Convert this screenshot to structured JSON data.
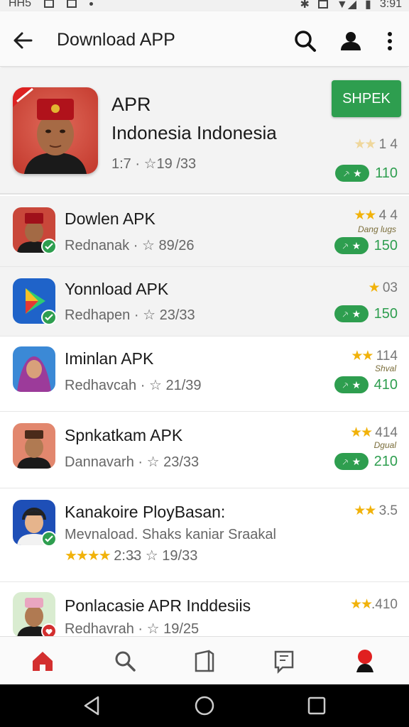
{
  "status_bar": {
    "left_text": "HH5",
    "right_text": "3:91"
  },
  "app_bar": {
    "title": "Download APP"
  },
  "featured": {
    "name": "APR",
    "subtitle": "Indonesia Indonesia",
    "meta_prefix": "1:7 ·",
    "meta_count": "19 /33",
    "install_label": "SHPEK",
    "rating_value": "1 4",
    "download_count": "110"
  },
  "apps": [
    {
      "name": "Dowlen APK",
      "publisher": "Rednanak ·",
      "count": "89/26",
      "rating_value": "4 4",
      "rating_sublabel": "Dang lugs",
      "download_count": "150",
      "icon": "person-fez-icon"
    },
    {
      "name": "Yonnload APK",
      "publisher": "Redhapen ·",
      "count": "23/33",
      "rating_value": "03",
      "rating_sublabel": "",
      "download_count": "150",
      "icon": "play-store-icon"
    },
    {
      "name": "Iminlan APK",
      "publisher": "Redhavcah ·",
      "count": "21/39",
      "rating_value": "114",
      "rating_sublabel": "Shval",
      "download_count": "410",
      "icon": "person-hijab-icon"
    },
    {
      "name": "Spnkatkam APK",
      "publisher": "Dannavarh ·",
      "count": "23/33",
      "rating_value": "414",
      "rating_sublabel": "Dgual",
      "download_count": "210",
      "icon": "person-peci-icon"
    },
    {
      "name": "Kanakoire PloyBasan:",
      "publisher": "Mevnaload. Shaks kaniar Sraakal",
      "stars_text": "2:3̵3",
      "count": "19/33",
      "rating_value": "3.5",
      "rating_sublabel": "",
      "download_count": "",
      "icon": "person-headset-icon"
    },
    {
      "name": "Ponlacasie APR Inddesiis",
      "publisher": "Redhavrah ·",
      "count": "19/25",
      "rating_value": ".410",
      "rating_sublabel": "",
      "download_count": "",
      "icon": "person-pink-cap-icon"
    }
  ],
  "colors": {
    "accent_green": "#2e9e4f",
    "star_yellow": "#f1b20a",
    "nav_active_red": "#d32f2f"
  }
}
